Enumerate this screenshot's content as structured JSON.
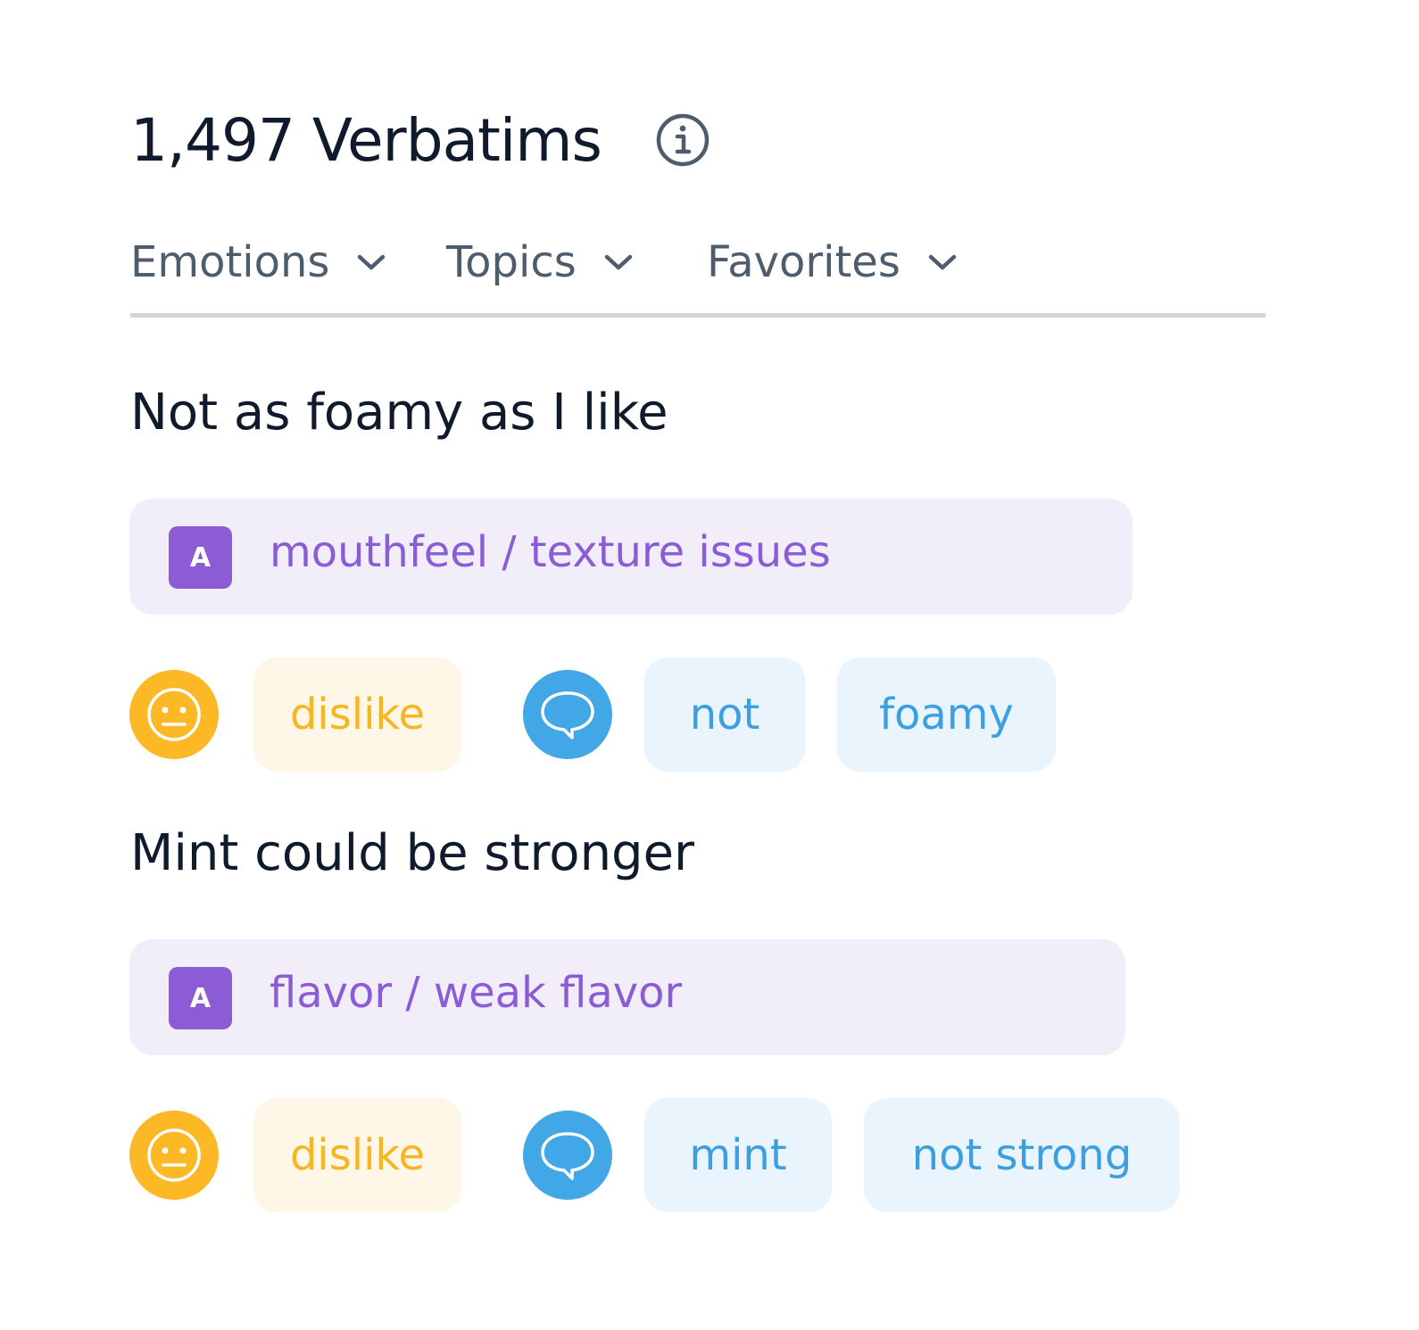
{
  "header": {
    "title": "1,497 Verbatims",
    "info_icon": "info-icon"
  },
  "filters": [
    {
      "label": "Emotions",
      "icon": "chevron-down-icon"
    },
    {
      "label": "Topics",
      "icon": "chevron-down-icon"
    },
    {
      "label": "Favorites",
      "icon": "chevron-down-icon"
    }
  ],
  "verbatims": [
    {
      "text": "Not as foamy as I like",
      "topic_badge": "A",
      "topic": "mouthfeel / texture issues",
      "emotion_icon": "neutral-face-icon",
      "emotion": "dislike",
      "keyword_icon": "speech-bubble-icon",
      "keywords": [
        "not",
        "foamy"
      ]
    },
    {
      "text": "Mint could be stronger",
      "topic_badge": "A",
      "topic": "flavor / weak flavor",
      "emotion_icon": "neutral-face-icon",
      "emotion": "dislike",
      "keyword_icon": "speech-bubble-icon",
      "keywords": [
        "mint",
        "not strong"
      ]
    }
  ],
  "colors": {
    "title": "#0f1b2d",
    "filter_text": "#4e5d6e",
    "topic_bg": "#f1eef9",
    "topic_accent": "#8b5cd6",
    "emotion_accent": "#fdb825",
    "emotion_chip_bg": "#fef6e6",
    "keyword_accent": "#42a7e6",
    "keyword_chip_bg": "#e9f4fc"
  }
}
